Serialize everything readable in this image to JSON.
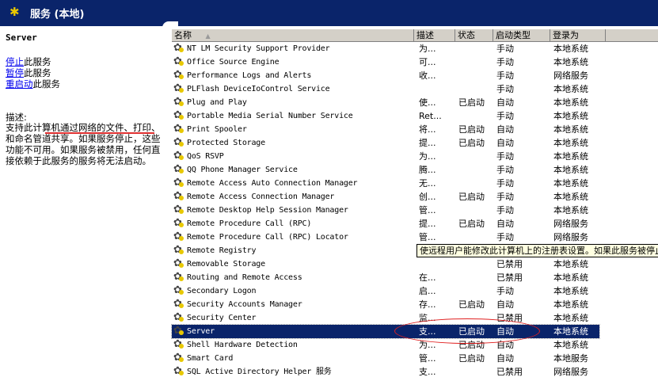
{
  "window": {
    "title": "服务 (本地)",
    "icon": "services-gear-icon"
  },
  "left_panel": {
    "service_name": "Server",
    "actions": [
      {
        "link": "停止",
        "suffix": "此服务"
      },
      {
        "link": "暂停",
        "suffix": "此服务"
      },
      {
        "link": "重启动",
        "suffix": "此服务"
      }
    ],
    "description_label": "描述:",
    "description": "支持此计算机通过网络的文件、打印、和命名管道共享。如果服务停止，这些功能不可用。如果服务被禁用，任何直接依赖于此服务的服务将无法启动。"
  },
  "columns": {
    "name": "名称",
    "sort_indicator": "▲",
    "desc": "描述",
    "status": "状态",
    "startup": "启动类型",
    "logon": "登录为"
  },
  "services": [
    [
      "NT LM Security Support Provider",
      "为...",
      "",
      "手动",
      "本地系统"
    ],
    [
      "Office Source Engine",
      "可...",
      "",
      "手动",
      "本地系统"
    ],
    [
      "Performance Logs and Alerts",
      "收...",
      "",
      "手动",
      "网络服务"
    ],
    [
      "PLFlash DeviceIoControl Service",
      "",
      "",
      "手动",
      "本地系统"
    ],
    [
      "Plug and Play",
      "使...",
      "已启动",
      "自动",
      "本地系统"
    ],
    [
      "Portable Media Serial Number Service",
      "Ret...",
      "",
      "手动",
      "本地系统"
    ],
    [
      "Print Spooler",
      "将...",
      "已启动",
      "自动",
      "本地系统"
    ],
    [
      "Protected Storage",
      "提...",
      "已启动",
      "自动",
      "本地系统"
    ],
    [
      "QoS RSVP",
      "为...",
      "",
      "手动",
      "本地系统"
    ],
    [
      "QQ Phone Manager Service",
      "腾...",
      "",
      "手动",
      "本地系统"
    ],
    [
      "Remote Access Auto Connection Manager",
      "无...",
      "",
      "手动",
      "本地系统"
    ],
    [
      "Remote Access Connection Manager",
      "创...",
      "已启动",
      "手动",
      "本地系统"
    ],
    [
      "Remote Desktop Help Session Manager",
      "管...",
      "",
      "手动",
      "本地系统"
    ],
    [
      "Remote Procedure Call (RPC)",
      "提...",
      "已启动",
      "自动",
      "网络服务"
    ],
    [
      "Remote Procedure Call (RPC) Locator",
      "管...",
      "",
      "手动",
      "网络服务"
    ],
    [
      "Remote Registry",
      "",
      "",
      "",
      ""
    ],
    [
      "Removable Storage",
      "",
      "",
      "已禁用",
      "本地系统"
    ],
    [
      "Routing and Remote Access",
      "在...",
      "",
      "已禁用",
      "本地系统"
    ],
    [
      "Secondary Logon",
      "启...",
      "",
      "手动",
      "本地系统"
    ],
    [
      "Security Accounts Manager",
      "存...",
      "已启动",
      "自动",
      "本地系统"
    ],
    [
      "Security Center",
      "监...",
      "",
      "已禁用",
      "本地系统"
    ],
    [
      "Server",
      "支...",
      "已启动",
      "自动",
      "本地系统"
    ],
    [
      "Shell Hardware Detection",
      "为...",
      "已启动",
      "自动",
      "本地系统"
    ],
    [
      "Smart Card",
      "管...",
      "已启动",
      "自动",
      "本地服务"
    ],
    [
      "SQL Active Directory Helper 服务",
      "支...",
      "",
      "已禁用",
      "网络服务"
    ]
  ],
  "selected_index": 21,
  "tooltip": "使远程用户能修改此计算机上的注册表设置。如果此服务被停止"
}
